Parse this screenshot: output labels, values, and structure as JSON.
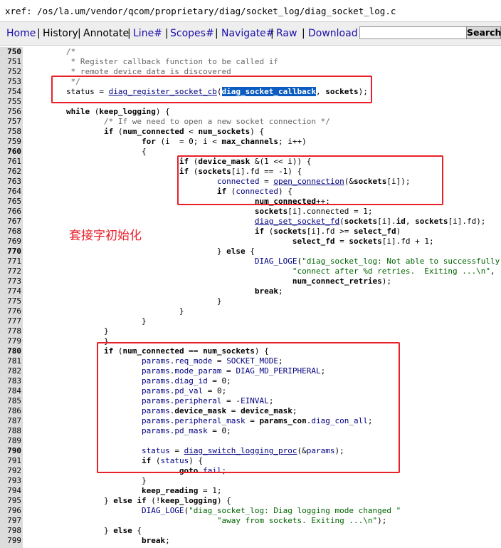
{
  "xref_path": "xref: /os/la.um/vendor/qcom/proprietary/diag/socket_log/diag_socket_log.c",
  "nav": {
    "home": "Home",
    "history": "History",
    "annotate": "Annotate",
    "line": "Line#",
    "scopes": "Scopes#",
    "navigate": "Navigate#",
    "raw": "Raw",
    "download": "Download",
    "search_value": "",
    "search_button": "Search"
  },
  "annotation": "套接字初始化",
  "colors": {
    "highlight_box": "#e8202a",
    "selection": "#0b5bc0",
    "gutter": "#dcdcdc"
  },
  "code": [
    {
      "ln": "750",
      "bold": true,
      "html": "        <span class=\"cm\">/*</span>"
    },
    {
      "ln": "751",
      "html": "         <span class=\"cm\">* Register callback function to be called if</span>"
    },
    {
      "ln": "752",
      "html": "         <span class=\"cm\">* remote device data is discovered</span>"
    },
    {
      "ln": "753",
      "html": "         <span class=\"cm\">*/</span>"
    },
    {
      "ln": "754",
      "html": "        status = <span class=\"fn\">diag_register_socket_cb</span>(<span class=\"sel\">diag_socket_callback</span>, <span class=\"kw\">sockets</span>);"
    },
    {
      "ln": "755",
      "html": ""
    },
    {
      "ln": "756",
      "html": "        <span class=\"kw\">while</span> (<span class=\"kw\">keep_logging</span>) {"
    },
    {
      "ln": "757",
      "html": "                <span class=\"cm\">/* If we need to open a new socket connection */</span>"
    },
    {
      "ln": "758",
      "html": "                <span class=\"kw\">if</span> (<span class=\"kw\">num_connected</span> &lt; <span class=\"kw\">num_sockets</span>) {"
    },
    {
      "ln": "759",
      "html": "                        <span class=\"kw\">for</span> (i  = 0; i &lt; <span class=\"kw\">max_channels</span>; i++)"
    },
    {
      "ln": "760",
      "bold": true,
      "html": "                        {"
    },
    {
      "ln": "761",
      "html": "                                <span class=\"kw\">if</span> (<span class=\"kw\">device_mask</span> &amp;(1 &lt;&lt; i)) {"
    },
    {
      "ln": "762",
      "html": "                                <span class=\"kw\">if</span> (<span class=\"kw\">sockets</span>[i].fd == -1) {"
    },
    {
      "ln": "763",
      "html": "                                        <span class=\"id\">connected</span> = <span class=\"fn\">open_connection</span>(&amp;<span class=\"kw\">sockets</span>[i]);"
    },
    {
      "ln": "764",
      "html": "                                        <span class=\"kw\">if</span> (<span class=\"id\">connected</span>) {"
    },
    {
      "ln": "765",
      "html": "                                                <span class=\"kw\">num_connected</span>++;"
    },
    {
      "ln": "766",
      "html": "                                                <span class=\"kw\">sockets</span>[i].connected = 1;"
    },
    {
      "ln": "767",
      "html": "                                                <span class=\"fn\">diag_set_socket_fd</span>(<span class=\"kw\">sockets</span>[i].<span class=\"kw\">id</span>, <span class=\"kw\">sockets</span>[i].fd);"
    },
    {
      "ln": "768",
      "html": "                                                <span class=\"kw\">if</span> (<span class=\"kw\">sockets</span>[i].fd &gt;= <span class=\"kw\">select_fd</span>)"
    },
    {
      "ln": "769",
      "html": "                                                        <span class=\"kw\">select_fd</span> = <span class=\"kw\">sockets</span>[i].fd + 1;"
    },
    {
      "ln": "770",
      "bold": true,
      "html": "                                        } <span class=\"kw\">else</span> {"
    },
    {
      "ln": "771",
      "html": "                                                <span class=\"id\">DIAG_LOGE</span>(<span class=\"st\">\"diag_socket_log: Not able to successfully \"</span>"
    },
    {
      "ln": "772",
      "html": "                                                        <span class=\"st\">\"connect after %d retries.  Exiting ...\\n\"</span>,"
    },
    {
      "ln": "773",
      "html": "                                                        <span class=\"kw\">num_connect_retries</span>);"
    },
    {
      "ln": "774",
      "html": "                                                <span class=\"kw\">break</span>;"
    },
    {
      "ln": "775",
      "html": "                                        }"
    },
    {
      "ln": "776",
      "html": "                                }"
    },
    {
      "ln": "777",
      "html": "                        }"
    },
    {
      "ln": "778",
      "html": "                }"
    },
    {
      "ln": "779",
      "html": "                }"
    },
    {
      "ln": "780",
      "bold": true,
      "html": "                <span class=\"kw\">if</span> (<span class=\"kw\">num_connected</span> == <span class=\"kw\">num_sockets</span>) {"
    },
    {
      "ln": "781",
      "html": "                        <span class=\"id\">params</span>.<span class=\"id\">req_mode</span> = <span class=\"id\">SOCKET_MODE</span>;"
    },
    {
      "ln": "782",
      "html": "                        <span class=\"id\">params</span>.<span class=\"id\">mode_param</span> = <span class=\"id\">DIAG_MD_PERIPHERAL</span>;"
    },
    {
      "ln": "783",
      "html": "                        <span class=\"id\">params</span>.<span class=\"id\">diag_id</span> = 0;"
    },
    {
      "ln": "784",
      "html": "                        <span class=\"id\">params</span>.<span class=\"id\">pd_val</span> = 0;"
    },
    {
      "ln": "785",
      "html": "                        <span class=\"id\">params</span>.<span class=\"id\">peripheral</span> = -<span class=\"id\">EINVAL</span>;"
    },
    {
      "ln": "786",
      "html": "                        <span class=\"id\">params</span>.<span class=\"kw\">device_mask</span> = <span class=\"kw\">device_mask</span>;"
    },
    {
      "ln": "787",
      "html": "                        <span class=\"id\">params</span>.<span class=\"id\">peripheral_mask</span> = <span class=\"kw\">params_con</span>.<span class=\"id\">diag_con_all</span>;"
    },
    {
      "ln": "788",
      "html": "                        <span class=\"id\">params</span>.<span class=\"id\">pd_mask</span> = 0;"
    },
    {
      "ln": "789",
      "html": ""
    },
    {
      "ln": "790",
      "bold": true,
      "html": "                        <span class=\"id\">status</span> = <span class=\"fn\">diag_switch_logging_proc</span>(&amp;<span class=\"id\">params</span>);"
    },
    {
      "ln": "791",
      "html": "                        <span class=\"kw\">if</span> (<span class=\"id\">status</span>) {"
    },
    {
      "ln": "792",
      "html": "                                <span class=\"kw\">goto</span> <span class=\"id\">fail</span>;"
    },
    {
      "ln": "793",
      "html": "                        }"
    },
    {
      "ln": "794",
      "html": "                        <span class=\"kw\">keep_reading</span> = 1;"
    },
    {
      "ln": "795",
      "html": "                } <span class=\"kw\">else if</span> (!<span class=\"kw\">keep_logging</span>) {"
    },
    {
      "ln": "796",
      "html": "                        <span class=\"id\">DIAG_LOGE</span>(<span class=\"st\">\"diag_socket_log: Diag logging mode changed \"</span>"
    },
    {
      "ln": "797",
      "html": "                                        <span class=\"st\">\"away from sockets. Exiting ...\\n\"</span>);"
    },
    {
      "ln": "798",
      "html": "                } <span class=\"kw\">else</span> {"
    },
    {
      "ln": "799",
      "html": "                        <span class=\"kw\">break</span>;"
    }
  ]
}
